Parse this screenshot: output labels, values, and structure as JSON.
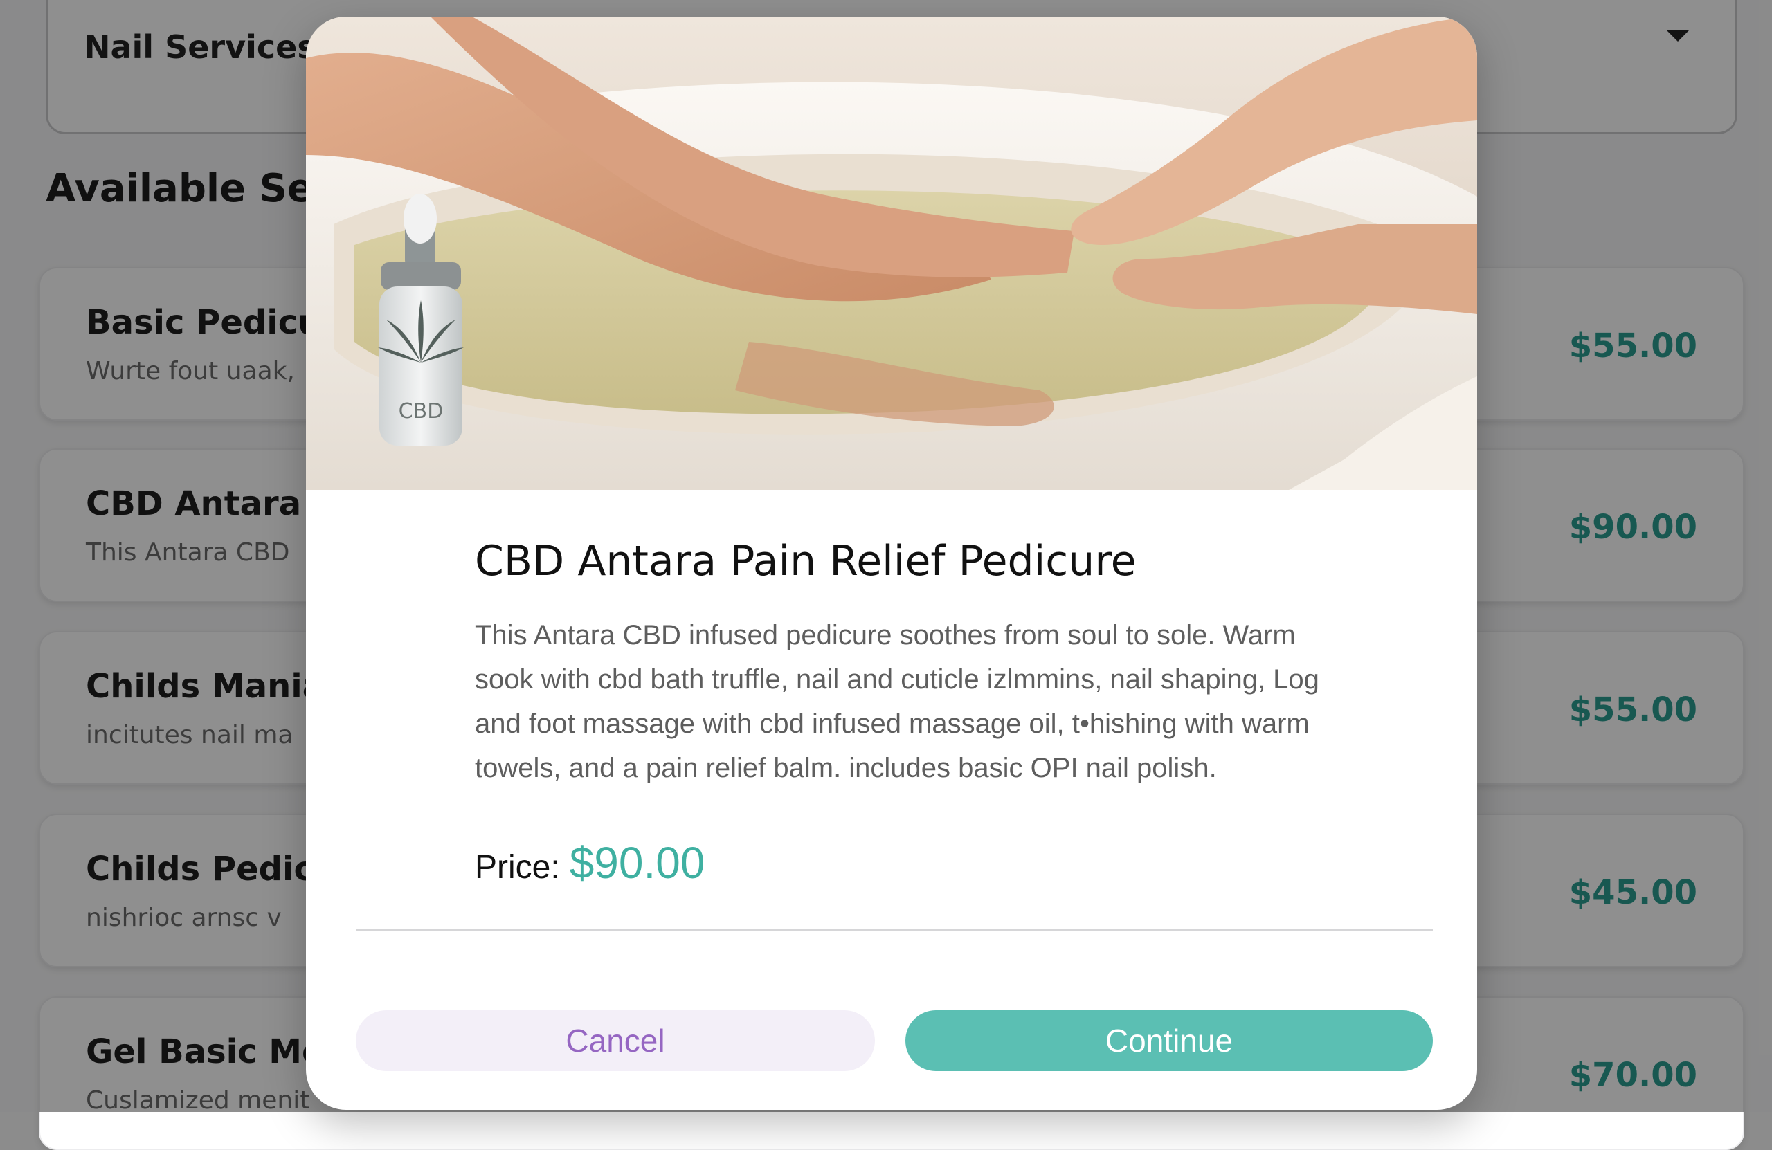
{
  "background": {
    "dropdown": {
      "value": "Nail Services"
    },
    "section_title": "Available Ser",
    "services": [
      {
        "name": "Basic Pedicu",
        "desc": "Wurte fout uaak,",
        "price": "$55.00"
      },
      {
        "name": "CBD Antara",
        "desc": "This Antara CBD",
        "price": "$90.00"
      },
      {
        "name": "Childs Mania",
        "desc": "incitutes nail ma",
        "price": "$55.00"
      },
      {
        "name": "Childs Pedicu",
        "desc": "nishrioc arnsc v",
        "price": "$45.00"
      },
      {
        "name": "Gel Basic Me",
        "desc": "Cuslamized menit",
        "price": "$70.00"
      }
    ]
  },
  "modal": {
    "image": {
      "bottle_label": "CBD"
    },
    "title": "CBD Antara Pain Relief Pedicure",
    "description": "This Antara CBD infused pedicure soothes from soul to sole. Warm sook with cbd bath truffle, nail and cuticle izlmmins, nail shaping, Log and foot massage with cbd infused massage oil, t•hishing with warm towels, and a pain relief balm. includes basic OPI nail polish.",
    "price_label": "Price:",
    "price_value": "$90.00",
    "cancel_label": "Cancel",
    "continue_label": "Continue"
  },
  "colors": {
    "accent_teal": "#5bbfb3",
    "price_teal": "#3fb0a1",
    "cancel_text": "#9566c2",
    "cancel_bg": "#f3eff8"
  }
}
